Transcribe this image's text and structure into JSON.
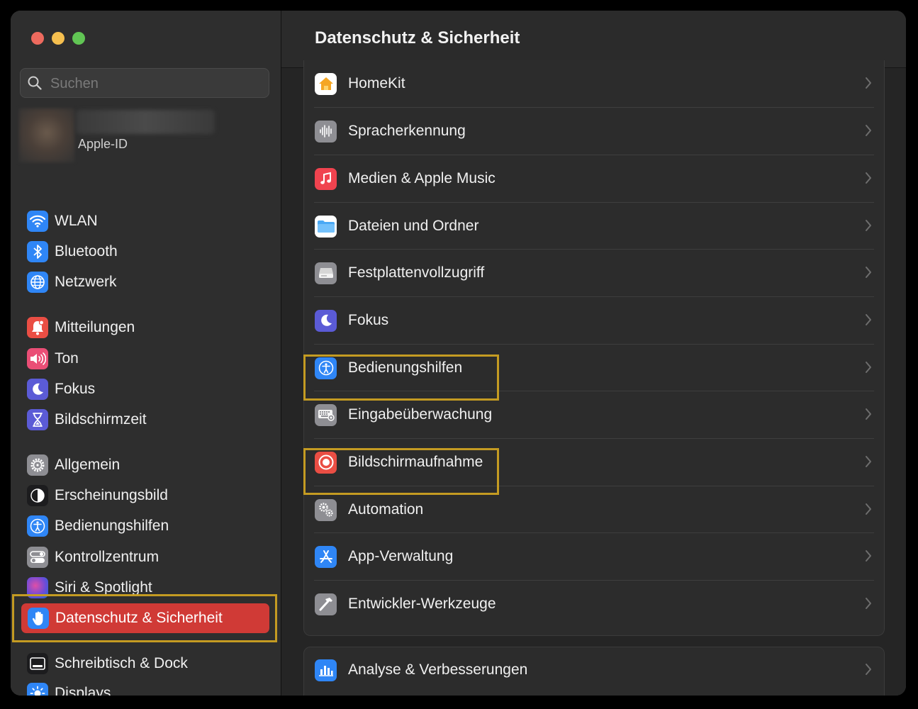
{
  "window": {
    "title": "Datenschutz & Sicherheit"
  },
  "sidebar": {
    "search_placeholder": "Suchen",
    "apple_id_label": "Apple-ID",
    "items": [
      {
        "label": "WLAN",
        "icon": "wifi-icon",
        "color": "#2f86f6"
      },
      {
        "label": "Bluetooth",
        "icon": "bluetooth-icon",
        "color": "#2f86f6"
      },
      {
        "label": "Netzwerk",
        "icon": "globe-icon",
        "color": "#2f86f6"
      },
      {
        "label": "Mitteilungen",
        "icon": "bell-icon",
        "color": "#ea4e44"
      },
      {
        "label": "Ton",
        "icon": "speaker-icon",
        "color": "#ea4e76"
      },
      {
        "label": "Fokus",
        "icon": "moon-icon",
        "color": "#5b5bd6"
      },
      {
        "label": "Bildschirmzeit",
        "icon": "hourglass-icon",
        "color": "#5b5bd6"
      },
      {
        "label": "Allgemein",
        "icon": "gear-icon",
        "color": "#8e8e93"
      },
      {
        "label": "Erscheinungsbild",
        "icon": "appearance-icon",
        "color": "#1c1c1e"
      },
      {
        "label": "Bedienungshilfen",
        "icon": "accessibility-icon",
        "color": "#2f86f6"
      },
      {
        "label": "Kontrollzentrum",
        "icon": "toggles-icon",
        "color": "#8e8e93"
      },
      {
        "label": "Siri & Spotlight",
        "icon": "siri-icon",
        "color": "#6e4bd8"
      },
      {
        "label": "Datenschutz & Sicherheit",
        "icon": "hand-icon",
        "color": "#2f86f6",
        "active": true
      },
      {
        "label": "Schreibtisch & Dock",
        "icon": "dock-icon",
        "color": "#1c1c1e"
      },
      {
        "label": "Displays",
        "icon": "sun-icon",
        "color": "#2f86f6"
      }
    ]
  },
  "main": {
    "title": "Datenschutz & Sicherheit",
    "group1": [
      {
        "label": "HomeKit",
        "icon": "home-icon",
        "color": "#ffffff"
      },
      {
        "label": "Spracherkennung",
        "icon": "waveform-icon",
        "color": "#8e8e93"
      },
      {
        "label": "Medien & Apple Music",
        "icon": "music-note-icon",
        "color": "#f0434f"
      },
      {
        "label": "Dateien und Ordner",
        "icon": "folder-icon",
        "color": "#4aa9f5"
      },
      {
        "label": "Festplattenvollzugriff",
        "icon": "disk-icon",
        "color": "#8e8e93"
      },
      {
        "label": "Fokus",
        "icon": "moon-icon",
        "color": "#5b5bd6"
      },
      {
        "label": "Bedienungshilfen",
        "icon": "accessibility-icon",
        "color": "#2f86f6"
      },
      {
        "label": "Eingabeüberwachung",
        "icon": "keyboard-icon",
        "color": "#8e8e93"
      },
      {
        "label": "Bildschirmaufnahme",
        "icon": "record-icon",
        "color": "#ea4e44"
      },
      {
        "label": "Automation",
        "icon": "gears-icon",
        "color": "#8e8e93"
      },
      {
        "label": "App-Verwaltung",
        "icon": "appstore-icon",
        "color": "#2f86f6"
      },
      {
        "label": "Entwickler-Werkzeuge",
        "icon": "hammer-icon",
        "color": "#8e8e93"
      }
    ],
    "group2": [
      {
        "label": "Analyse & Verbesserungen",
        "icon": "chart-icon",
        "color": "#2f86f6"
      }
    ]
  }
}
